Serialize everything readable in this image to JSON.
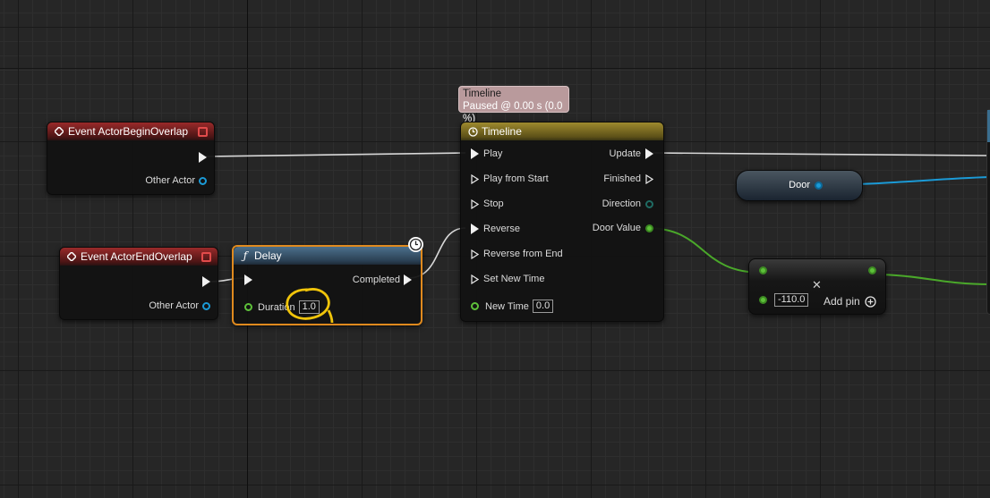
{
  "tooltip": {
    "line1": "Timeline",
    "line2": "Paused @ 0.00 s (0.0 %)"
  },
  "begin_overlap": {
    "title": "Event ActorBeginOverlap",
    "other_actor": "Other Actor"
  },
  "end_overlap": {
    "title": "Event ActorEndOverlap",
    "other_actor": "Other Actor"
  },
  "delay": {
    "icon": "function-icon",
    "title": "Delay",
    "completed": "Completed",
    "duration_label": "Duration",
    "duration_value": "1.0"
  },
  "timeline": {
    "title": "Timeline",
    "inputs": [
      "Play",
      "Play from Start",
      "Stop",
      "Reverse",
      "Reverse from End",
      "Set New Time"
    ],
    "new_time_label": "New Time",
    "new_time_value": "0.0",
    "outputs": {
      "update": "Update",
      "finished": "Finished",
      "direction": "Direction",
      "door_value": "Door Value"
    }
  },
  "door_var": {
    "label": "Door"
  },
  "add_node": {
    "value": "-110.0",
    "add_pin": "Add pin"
  },
  "colors": {
    "exec": "#f0f0f0",
    "object_pin": "#1b9ad6",
    "float_pin": "#5ec13a",
    "highlight": "#f0c40a",
    "delay_border": "#e08a1e"
  }
}
